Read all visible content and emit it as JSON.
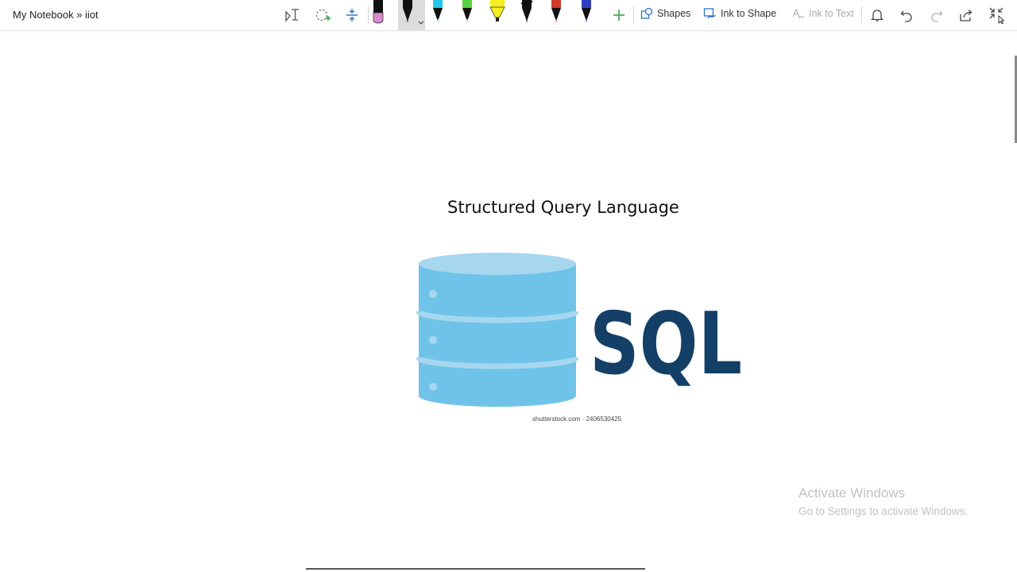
{
  "breadcrumb": "My Notebook » iiot",
  "toolbar": {
    "icons": [
      "lasso-select-icon",
      "add-space-icon",
      "insert-space-icon"
    ],
    "pens": [
      {
        "name": "pink-marker",
        "color": "#d98ad0"
      },
      {
        "name": "black-pen",
        "color": "#111111",
        "selected": true
      },
      {
        "name": "cyan-pen",
        "color": "#22c7e8"
      },
      {
        "name": "green-pen",
        "color": "#58d13f"
      },
      {
        "name": "yellow-highlighter",
        "color": "#f6ee1e"
      },
      {
        "name": "black-felt-pen",
        "color": "#111111"
      },
      {
        "name": "red-pen",
        "color": "#d23b2b"
      },
      {
        "name": "blue-pen",
        "color": "#2f3fbf"
      }
    ],
    "add_pen_icon": "plus-icon",
    "shapes_label": "Shapes",
    "ink_to_shape_label": "Ink to Shape",
    "ink_to_text_label": "Ink to Text",
    "action_icons": [
      "bell-icon",
      "undo-icon",
      "redo-icon",
      "share-icon",
      "exit-fullscreen-icon"
    ]
  },
  "page": {
    "title": "Structured Query Language",
    "image_text": "SQL",
    "image_caption": "shutterstock.com · 2406530425",
    "colors": {
      "db_blue": "#70c3e8",
      "db_light": "#a6d7ef",
      "sql_navy": "#143f66"
    }
  },
  "watermark": {
    "title": "Activate Windows",
    "subtitle": "Go to Settings to activate Windows."
  }
}
